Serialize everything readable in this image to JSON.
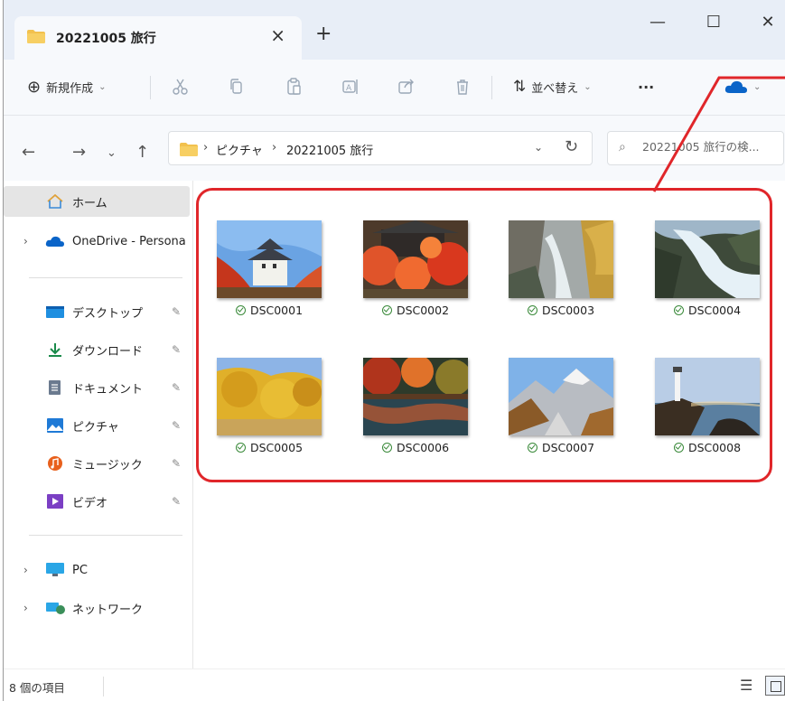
{
  "tab": {
    "title": "20221005 旅行",
    "close": "×",
    "new_tab": "+"
  },
  "window_controls": {
    "minimize": "—",
    "maximize": "☐",
    "close": "✕"
  },
  "toolbar": {
    "new_label": "新規作成",
    "new_icon": "⊕",
    "sort_label": "並べ替え",
    "sort_icon": "⇅",
    "more": "···",
    "chevron": "⌄",
    "icons": [
      "scissors-icon",
      "copy-icon",
      "paste-icon",
      "rename-icon",
      "share-icon",
      "delete-icon"
    ]
  },
  "nav": {
    "back": "←",
    "forward": "→",
    "recent": "⌄",
    "up": "↑"
  },
  "address": {
    "crumbs": [
      "ピクチャ",
      "20221005 旅行"
    ],
    "separator": "›",
    "dropdown": "⌄",
    "refresh": "↻"
  },
  "search": {
    "placeholder": "20221005 旅行の検...",
    "icon": "⌕"
  },
  "sidebar": {
    "home": "ホーム",
    "onedrive": "OneDrive - Persona",
    "quick": [
      {
        "label": "デスクトップ",
        "icon": "desktop-icon"
      },
      {
        "label": "ダウンロード",
        "icon": "download-icon"
      },
      {
        "label": "ドキュメント",
        "icon": "document-icon"
      },
      {
        "label": "ピクチャ",
        "icon": "pictures-icon"
      },
      {
        "label": "ミュージック",
        "icon": "music-icon"
      },
      {
        "label": "ビデオ",
        "icon": "video-icon"
      }
    ],
    "pin": "📌",
    "expand": "›",
    "pc": "PC",
    "network": "ネットワーク"
  },
  "files": [
    {
      "name": "DSC0001",
      "scene": "castle"
    },
    {
      "name": "DSC0002",
      "scene": "maple"
    },
    {
      "name": "DSC0003",
      "scene": "gorge"
    },
    {
      "name": "DSC0004",
      "scene": "waterfall"
    },
    {
      "name": "DSC0005",
      "scene": "ginkgo"
    },
    {
      "name": "DSC0006",
      "scene": "pond"
    },
    {
      "name": "DSC0007",
      "scene": "mountain"
    },
    {
      "name": "DSC0008",
      "scene": "lighthouse"
    }
  ],
  "status": {
    "count": "8 個の項目"
  },
  "colors": {
    "highlight": "#e0262a",
    "accent": "#0067c0",
    "folder": "#f2c14e"
  }
}
